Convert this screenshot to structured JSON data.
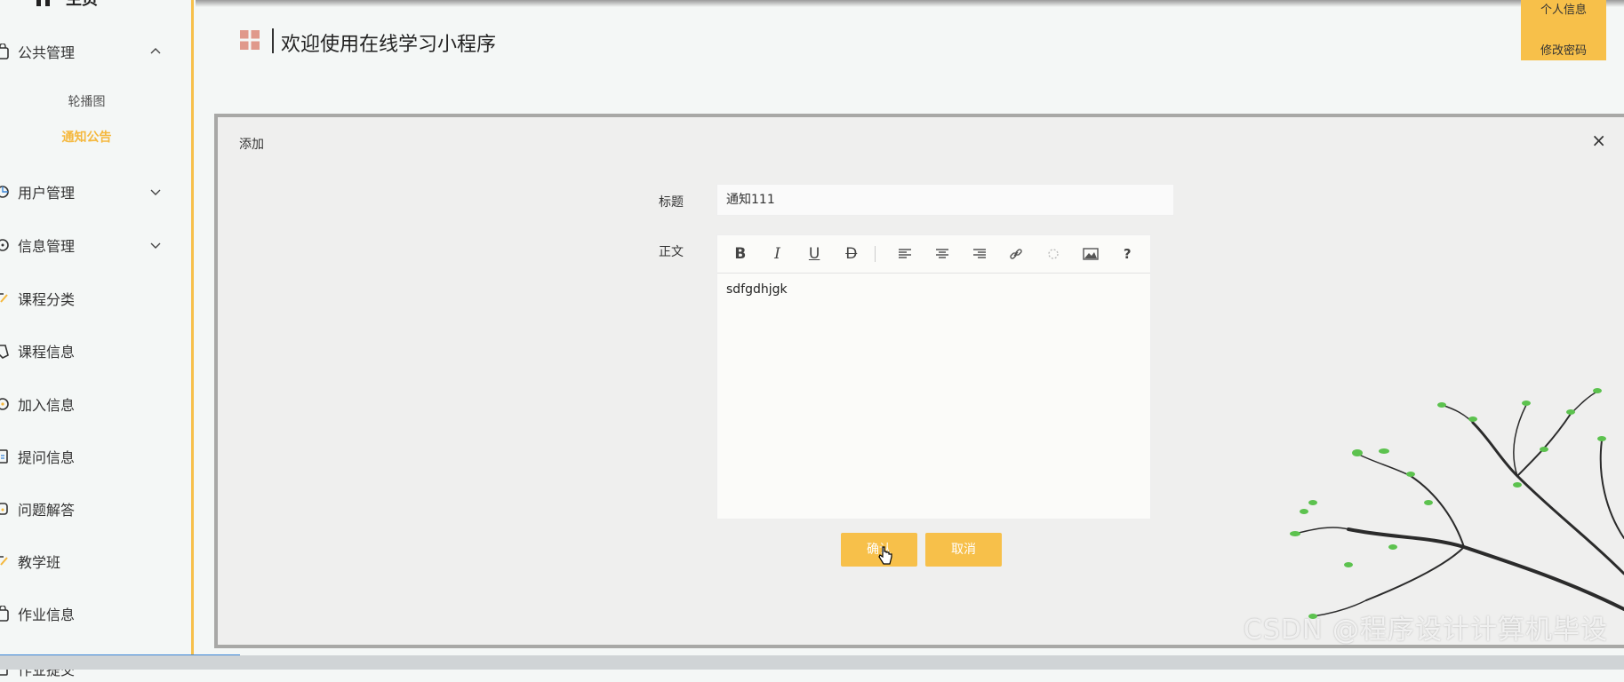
{
  "sidebar": {
    "home_label": "主页",
    "items": [
      {
        "label": "公共管理",
        "expanded": true,
        "icon": "bag-icon"
      },
      {
        "label": "用户管理",
        "expanded": false,
        "icon": "pie-icon"
      },
      {
        "label": "信息管理",
        "expanded": false,
        "icon": "info-circle-icon"
      },
      {
        "label": "课程分类",
        "icon": "edit-icon"
      },
      {
        "label": "课程信息",
        "icon": "tag-icon"
      },
      {
        "label": "加入信息",
        "icon": "plus-circle-icon"
      },
      {
        "label": "提问信息",
        "icon": "doc-icon"
      },
      {
        "label": "问题解答",
        "icon": "cylinder-icon"
      },
      {
        "label": "教学班",
        "icon": "edit2-icon"
      },
      {
        "label": "作业信息",
        "icon": "bag2-icon"
      },
      {
        "label": "作业提交",
        "icon": "file-icon"
      }
    ],
    "sub_items": [
      {
        "label": "轮播图",
        "active": false
      },
      {
        "label": "通知公告",
        "active": true
      }
    ]
  },
  "header": {
    "title": "欢迎使用在线学习小程序",
    "user_menu": {
      "profile": "个人信息",
      "change_password": "修改密码"
    }
  },
  "dialog": {
    "title": "添加",
    "close": "×",
    "fields": {
      "title_label": "标题",
      "title_value": "通知111",
      "body_label": "正文",
      "body_value": "sdfgdhjgk"
    },
    "toolbar": [
      "bold",
      "italic",
      "underline",
      "strikethrough",
      "align-left",
      "align-center",
      "align-right",
      "link",
      "unlink",
      "image",
      "help"
    ],
    "confirm_label": "确认",
    "cancel_label": "取消"
  },
  "watermark": "CSDN @程序设计计算机毕设",
  "colors": {
    "accent": "#f7c04a",
    "active_text": "#f5b83d",
    "dialog_bg": "#efefee",
    "page_bg": "#f4f7f6"
  }
}
